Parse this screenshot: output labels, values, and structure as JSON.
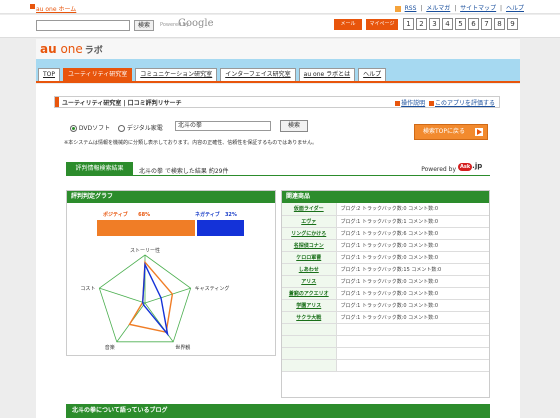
{
  "topbar": {
    "home_link": "au one ホーム",
    "links": [
      "RSS",
      "メルマガ",
      "サイトマップ",
      "ヘルプ"
    ]
  },
  "searchbar": {
    "search_button": "検索",
    "powered_text": "Powered by",
    "google": "Google",
    "mail_button": "メール",
    "mypage_button": "マイページ",
    "number_tabs": [
      "1",
      "2",
      "3",
      "4",
      "5",
      "6",
      "7",
      "8",
      "9"
    ]
  },
  "header": {
    "logo_au": "au",
    "logo_one": " one",
    "logo_labo": "ラボ",
    "nav": [
      {
        "label": "TOP",
        "active": false
      },
      {
        "label": "ユーティリティ研究室",
        "active": true
      },
      {
        "label": "コミュニケーション研究室",
        "active": false
      },
      {
        "label": "インターフェイス研究室",
        "active": false
      },
      {
        "label": "au one ラボとは",
        "active": false
      },
      {
        "label": "ヘルプ",
        "active": false
      }
    ]
  },
  "breadcrumb": {
    "text": "ユーティリティ研究室 | 口コミ評判リサーチ",
    "link_howto": "操作説明",
    "link_rate": "このアプリを評価する"
  },
  "search": {
    "option_dvd": "DVDソフト",
    "option_camera": "デジタル家電",
    "selected": "DVDソフト",
    "keyword": "北斗の拳",
    "button": "検索",
    "disclaimer": "※本システムは情報を機械的に分類し表示しております。内容の正確性、信頼性を保証するものではありません。",
    "back_button": "検索TOPに戻る"
  },
  "results": {
    "tab": "評判情報検索結果",
    "summary": "北斗の拳 で検索した結果 約29件",
    "powered_by": "Powered by",
    "ask": "Ask",
    "jp": ".jp"
  },
  "graph": {
    "title": "評判判定グラフ",
    "positive_label": "ポジティブ",
    "positive_value": 68,
    "negative_label": "ネガティブ",
    "negative_value": 32,
    "positive_pct_text": "68%",
    "negative_pct_text": "32%",
    "colors": {
      "positive": "#f07d26",
      "negative": "#1432d8",
      "axes": "#4caf50"
    },
    "radar": {
      "axes": [
        "ストーリー性",
        "キャスティング",
        "世界観",
        "音楽",
        "コスト"
      ],
      "positive": [
        0.85,
        0.6,
        0.75,
        0.55,
        0.05
      ],
      "negative": [
        0.8,
        0.35,
        0.8,
        0.05,
        0.05
      ]
    }
  },
  "related": {
    "title": "関連商品",
    "items": [
      {
        "name": "仮面ライダー",
        "info": "ブログ:2 トラックバック数:0 コメント数:0"
      },
      {
        "name": "エヴァ",
        "info": "ブログ:1 トラックバック数:1 コメント数:0"
      },
      {
        "name": "リングにかけろ",
        "info": "ブログ:1 トラックバック数:6 コメント数:0"
      },
      {
        "name": "名探偵コナン",
        "info": "ブログ:1 トラックバック数:0 コメント数:0"
      },
      {
        "name": "ケロロ軍曹",
        "info": "ブログ:1 トラックバック数:0 コメント数:0"
      },
      {
        "name": "しあわせ",
        "info": "ブログ:1 トラックバック数:15 コメント数:0"
      },
      {
        "name": "アリス",
        "info": "ブログ:1 トラックバック数:0 コメント数:0"
      },
      {
        "name": "蒼窮のアクエリオ",
        "info": "ブログ:1 トラックバック数:0 コメント数:0"
      },
      {
        "name": "学園アリス",
        "info": "ブログ:1 トラックバック数:0 コメント数:0"
      },
      {
        "name": "サクラ大戦",
        "info": "ブログ:1 トラックバック数:0 コメント数:0"
      }
    ]
  },
  "blog_section": {
    "title": "北斗の拳について語っているブログ"
  }
}
